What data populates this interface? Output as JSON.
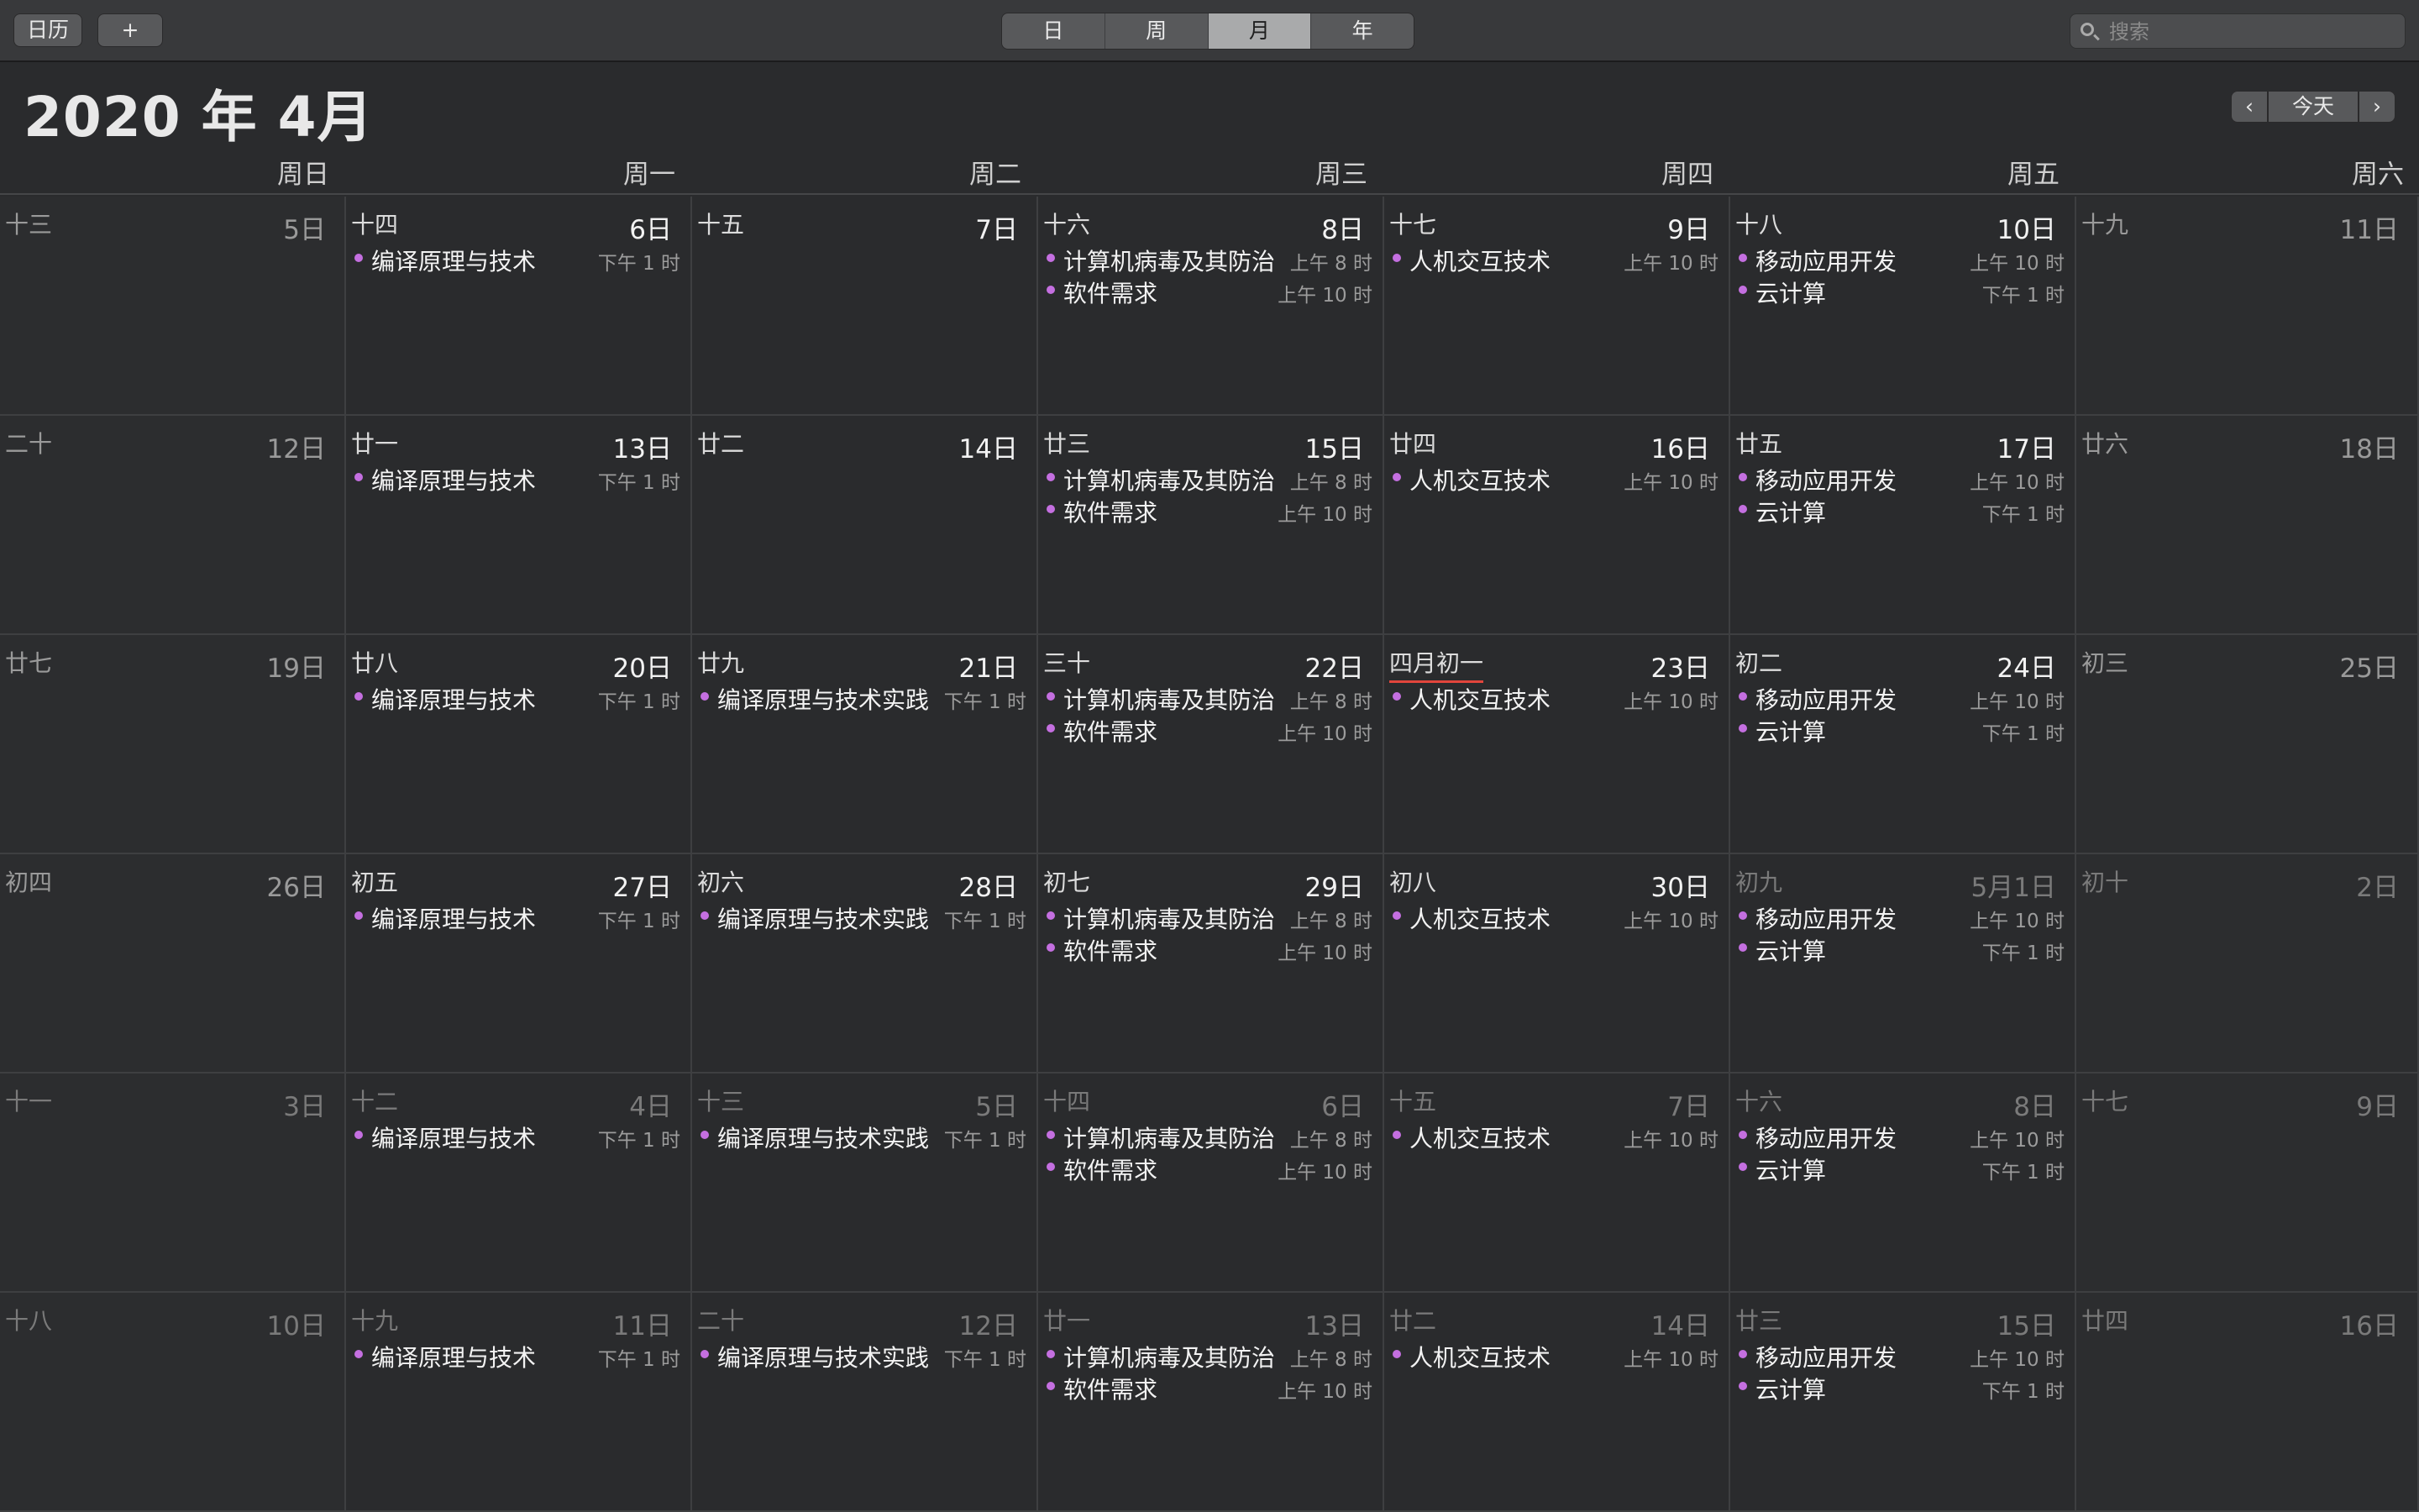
{
  "toolbar": {
    "calendars_label": "日历",
    "add_label": "+",
    "views": [
      {
        "label": "日",
        "active": false
      },
      {
        "label": "周",
        "active": false
      },
      {
        "label": "月",
        "active": true
      },
      {
        "label": "年",
        "active": false
      }
    ],
    "search_placeholder": "搜索"
  },
  "header": {
    "month_title": "2020 年 4月",
    "prev_label": "‹",
    "today_label": "今天",
    "next_label": "›"
  },
  "weekdays": [
    "周日",
    "周一",
    "周二",
    "周三",
    "周四",
    "周五",
    "周六"
  ],
  "event_color": "#c46fe0",
  "today_underline_color": "#e2453c",
  "weeks": [
    [
      {
        "lunar": "十三",
        "day": "5日",
        "other": false,
        "events": []
      },
      {
        "lunar": "十四",
        "day": "6日",
        "other": false,
        "events": [
          {
            "title": "编译原理与技术",
            "time": "下午 1 时"
          }
        ]
      },
      {
        "lunar": "十五",
        "day": "7日",
        "other": false,
        "events": []
      },
      {
        "lunar": "十六",
        "day": "8日",
        "other": false,
        "events": [
          {
            "title": "计算机病毒及其防治",
            "time": "上午 8 时"
          },
          {
            "title": "软件需求",
            "time": "上午 10 时"
          }
        ]
      },
      {
        "lunar": "十七",
        "day": "9日",
        "other": false,
        "events": [
          {
            "title": "人机交互技术",
            "time": "上午 10 时"
          }
        ]
      },
      {
        "lunar": "十八",
        "day": "10日",
        "other": false,
        "events": [
          {
            "title": "移动应用开发",
            "time": "上午 10 时"
          },
          {
            "title": "云计算",
            "time": "下午 1 时"
          }
        ]
      },
      {
        "lunar": "十九",
        "day": "11日",
        "other": false,
        "events": []
      }
    ],
    [
      {
        "lunar": "二十",
        "day": "12日",
        "other": false,
        "events": []
      },
      {
        "lunar": "廿一",
        "day": "13日",
        "other": false,
        "events": [
          {
            "title": "编译原理与技术",
            "time": "下午 1 时"
          }
        ]
      },
      {
        "lunar": "廿二",
        "day": "14日",
        "other": false,
        "events": []
      },
      {
        "lunar": "廿三",
        "day": "15日",
        "other": false,
        "events": [
          {
            "title": "计算机病毒及其防治",
            "time": "上午 8 时"
          },
          {
            "title": "软件需求",
            "time": "上午 10 时"
          }
        ]
      },
      {
        "lunar": "廿四",
        "day": "16日",
        "other": false,
        "events": [
          {
            "title": "人机交互技术",
            "time": "上午 10 时"
          }
        ]
      },
      {
        "lunar": "廿五",
        "day": "17日",
        "other": false,
        "events": [
          {
            "title": "移动应用开发",
            "time": "上午 10 时"
          },
          {
            "title": "云计算",
            "time": "下午 1 时"
          }
        ]
      },
      {
        "lunar": "廿六",
        "day": "18日",
        "other": false,
        "events": []
      }
    ],
    [
      {
        "lunar": "廿七",
        "day": "19日",
        "other": false,
        "events": []
      },
      {
        "lunar": "廿八",
        "day": "20日",
        "other": false,
        "events": [
          {
            "title": "编译原理与技术",
            "time": "下午 1 时"
          }
        ]
      },
      {
        "lunar": "廿九",
        "day": "21日",
        "other": false,
        "events": [
          {
            "title": "编译原理与技术实践",
            "time": "下午 1 时"
          }
        ]
      },
      {
        "lunar": "三十",
        "day": "22日",
        "other": false,
        "events": [
          {
            "title": "计算机病毒及其防治",
            "time": "上午 8 时"
          },
          {
            "title": "软件需求",
            "time": "上午 10 时"
          }
        ]
      },
      {
        "lunar": "四月初一",
        "day": "23日",
        "other": false,
        "today": true,
        "events": [
          {
            "title": "人机交互技术",
            "time": "上午 10 时"
          }
        ]
      },
      {
        "lunar": "初二",
        "day": "24日",
        "other": false,
        "events": [
          {
            "title": "移动应用开发",
            "time": "上午 10 时"
          },
          {
            "title": "云计算",
            "time": "下午 1 时"
          }
        ]
      },
      {
        "lunar": "初三",
        "day": "25日",
        "other": false,
        "events": []
      }
    ],
    [
      {
        "lunar": "初四",
        "day": "26日",
        "other": false,
        "events": []
      },
      {
        "lunar": "初五",
        "day": "27日",
        "other": false,
        "events": [
          {
            "title": "编译原理与技术",
            "time": "下午 1 时"
          }
        ]
      },
      {
        "lunar": "初六",
        "day": "28日",
        "other": false,
        "events": [
          {
            "title": "编译原理与技术实践",
            "time": "下午 1 时"
          }
        ]
      },
      {
        "lunar": "初七",
        "day": "29日",
        "other": false,
        "events": [
          {
            "title": "计算机病毒及其防治",
            "time": "上午 8 时"
          },
          {
            "title": "软件需求",
            "time": "上午 10 时"
          }
        ]
      },
      {
        "lunar": "初八",
        "day": "30日",
        "other": false,
        "events": [
          {
            "title": "人机交互技术",
            "time": "上午 10 时"
          }
        ]
      },
      {
        "lunar": "初九",
        "day": "5月1日",
        "other": true,
        "events": [
          {
            "title": "移动应用开发",
            "time": "上午 10 时"
          },
          {
            "title": "云计算",
            "time": "下午 1 时"
          }
        ]
      },
      {
        "lunar": "初十",
        "day": "2日",
        "other": true,
        "events": []
      }
    ],
    [
      {
        "lunar": "十一",
        "day": "3日",
        "other": true,
        "events": []
      },
      {
        "lunar": "十二",
        "day": "4日",
        "other": true,
        "events": [
          {
            "title": "编译原理与技术",
            "time": "下午 1 时"
          }
        ]
      },
      {
        "lunar": "十三",
        "day": "5日",
        "other": true,
        "events": [
          {
            "title": "编译原理与技术实践",
            "time": "下午 1 时"
          }
        ]
      },
      {
        "lunar": "十四",
        "day": "6日",
        "other": true,
        "events": [
          {
            "title": "计算机病毒及其防治",
            "time": "上午 8 时"
          },
          {
            "title": "软件需求",
            "time": "上午 10 时"
          }
        ]
      },
      {
        "lunar": "十五",
        "day": "7日",
        "other": true,
        "events": [
          {
            "title": "人机交互技术",
            "time": "上午 10 时"
          }
        ]
      },
      {
        "lunar": "十六",
        "day": "8日",
        "other": true,
        "events": [
          {
            "title": "移动应用开发",
            "time": "上午 10 时"
          },
          {
            "title": "云计算",
            "time": "下午 1 时"
          }
        ]
      },
      {
        "lunar": "十七",
        "day": "9日",
        "other": true,
        "events": []
      }
    ],
    [
      {
        "lunar": "十八",
        "day": "10日",
        "other": true,
        "events": []
      },
      {
        "lunar": "十九",
        "day": "11日",
        "other": true,
        "events": [
          {
            "title": "编译原理与技术",
            "time": "下午 1 时"
          }
        ]
      },
      {
        "lunar": "二十",
        "day": "12日",
        "other": true,
        "events": [
          {
            "title": "编译原理与技术实践",
            "time": "下午 1 时"
          }
        ]
      },
      {
        "lunar": "廿一",
        "day": "13日",
        "other": true,
        "events": [
          {
            "title": "计算机病毒及其防治",
            "time": "上午 8 时"
          },
          {
            "title": "软件需求",
            "time": "上午 10 时"
          }
        ]
      },
      {
        "lunar": "廿二",
        "day": "14日",
        "other": true,
        "events": [
          {
            "title": "人机交互技术",
            "time": "上午 10 时"
          }
        ]
      },
      {
        "lunar": "廿三",
        "day": "15日",
        "other": true,
        "events": [
          {
            "title": "移动应用开发",
            "time": "上午 10 时"
          },
          {
            "title": "云计算",
            "time": "下午 1 时"
          }
        ]
      },
      {
        "lunar": "廿四",
        "day": "16日",
        "other": true,
        "events": []
      }
    ]
  ]
}
